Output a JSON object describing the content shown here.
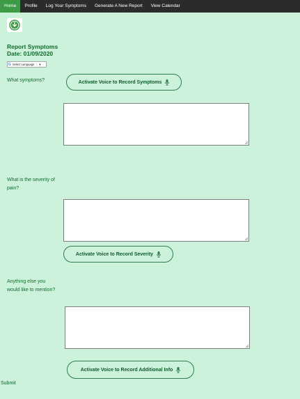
{
  "nav": {
    "items": [
      {
        "label": "Home",
        "active": true
      },
      {
        "label": "Profile"
      },
      {
        "label": "Log Your Symptoms"
      },
      {
        "label": "Generate A New Report"
      },
      {
        "label": "View Calendar"
      }
    ]
  },
  "logo_icon": "leaf-download-icon",
  "heading": {
    "title": "Report Symptoms",
    "date": "Date: 01/09/2020"
  },
  "language": {
    "icon": "google-g-icon",
    "label": "Select Language",
    "caret": "▼"
  },
  "form": {
    "symptoms_question": "What symptoms?",
    "symptoms_voice_button": "Activate Voice to Record Symptoms",
    "severity_question": "What is the severity of pain?",
    "severity_voice_button": "Activate Voice to Record Severity",
    "extra_question": "Anything else you would like to mention?",
    "extra_voice_button": "Activate Voice to Record Additional Info",
    "submit_label": "Submit",
    "mic_icon": "microphone-icon"
  },
  "colors": {
    "background": "#cdf2dc",
    "navbar": "#2b2b2b",
    "nav_active": "#3d9b45",
    "accent_text": "#0f6b2c"
  }
}
